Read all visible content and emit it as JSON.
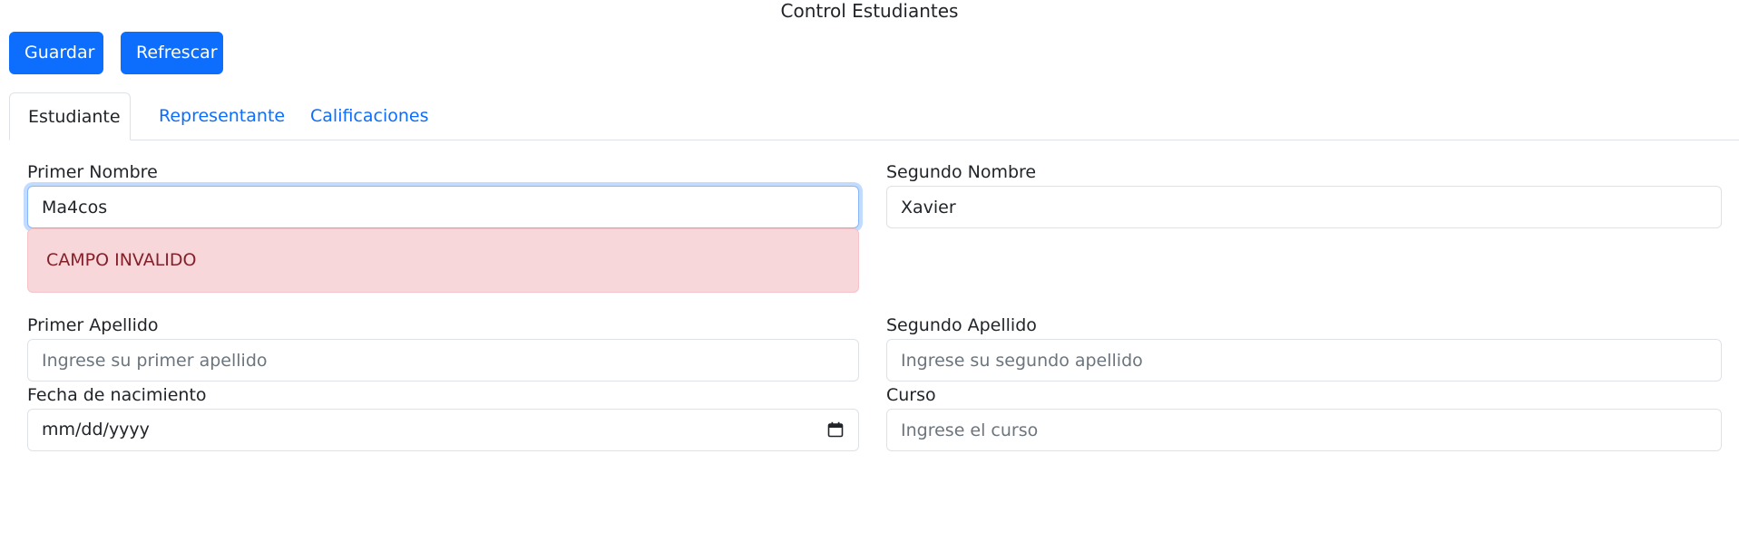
{
  "header": {
    "title": "Control Estudiantes"
  },
  "toolbar": {
    "save_label": "Guardar",
    "refresh_label": "Refrescar"
  },
  "tabs": [
    {
      "label": "Estudiante",
      "active": true
    },
    {
      "label": "Representante",
      "active": false
    },
    {
      "label": "Calificaciones",
      "active": false
    }
  ],
  "form": {
    "primer_nombre": {
      "label": "Primer Nombre",
      "value": "Ma4cos",
      "error": "CAMPO INVALIDO"
    },
    "segundo_nombre": {
      "label": "Segundo Nombre",
      "value": "Xavier"
    },
    "primer_apellido": {
      "label": "Primer Apellido",
      "placeholder": "Ingrese su primer apellido",
      "value": ""
    },
    "segundo_apellido": {
      "label": "Segundo Apellido",
      "placeholder": "Ingrese su segundo apellido",
      "value": ""
    },
    "fecha_nacimiento": {
      "label": "Fecha de nacimiento",
      "placeholder": "mm/dd/yyyy",
      "icon": "calendar-icon"
    },
    "curso": {
      "label": "Curso",
      "placeholder": "Ingrese el curso",
      "value": ""
    }
  },
  "colors": {
    "primary": "#0d6efd",
    "danger_bg": "#f8d7da",
    "danger_text": "#842029",
    "border": "#dee2e6",
    "focus": "#86b7fe"
  }
}
